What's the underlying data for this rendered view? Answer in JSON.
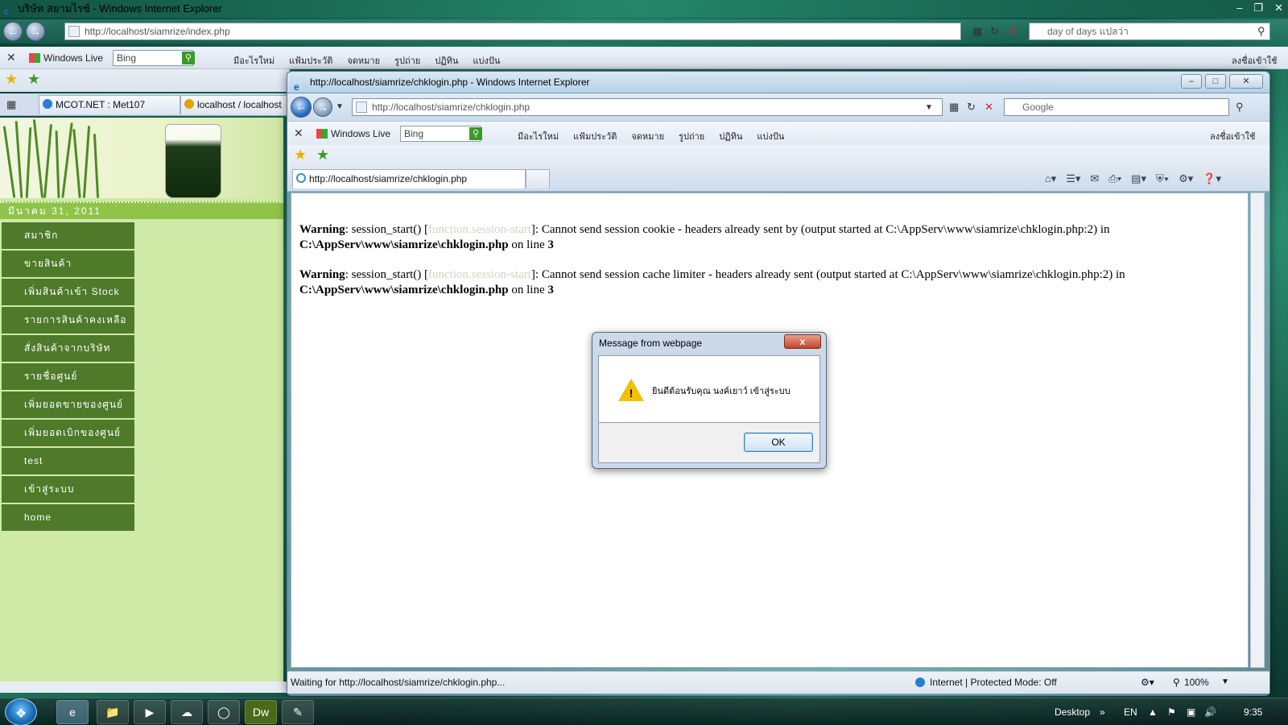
{
  "back_window": {
    "title": "บริษัท สยามไรซ์ - Windows Internet Explorer",
    "address": "http://localhost/siamrize/index.php",
    "search_placeholder": "day of days แปลว่า",
    "live_toolbar": {
      "brand": "Windows Live",
      "search_value": "Bing",
      "menu": [
        "มีอะไรใหม่",
        "แฟ้มประวัติ",
        "จดหมาย",
        "รูปถ่าย",
        "ปฏิทิน",
        "แบ่งปัน"
      ],
      "sign_in": "ลงชื่อเข้าใช้"
    },
    "tabs": [
      {
        "label": "MCOT.NET : Met107"
      },
      {
        "label": "localhost / localhost"
      }
    ],
    "page": {
      "date": "มีนาคม 31, 2011",
      "nav": [
        "สมาชิก",
        "ขายสินค้า",
        "เพิ่มสินค้าเข้า Stock",
        "รายการสินค้าคงเหลือ",
        "สั่งสินค้าจากบริษัท",
        "รายชื่อศูนย์",
        "เพิ่มยอดขายของศูนย์",
        "เพิ่มยอดเบิกของศูนย์",
        "test",
        "เข้าสู่ระบบ",
        "home"
      ]
    }
  },
  "front_window": {
    "title": "http://localhost/siamrize/chklogin.php - Windows Internet Explorer",
    "address": "http://localhost/siamrize/chklogin.php",
    "search_placeholder": "Google",
    "live_toolbar": {
      "brand": "Windows Live",
      "search_value": "Bing",
      "menu": [
        "มีอะไรใหม่",
        "แฟ้มประวัติ",
        "จดหมาย",
        "รูปถ่าย",
        "ปฏิทิน",
        "แบ่งปัน"
      ],
      "sign_in": "ลงชื่อเข้าใช้"
    },
    "tab_label": "http://localhost/siamrize/chklogin.php",
    "warnings": [
      {
        "label": "Warning",
        "pre": ": session_start() [",
        "fn": "function.session-start",
        "post": "]: Cannot send session cookie - headers already sent by (output started at C:\\AppServ\\www\\siamrize\\chklogin.php:2) in",
        "file": "C:\\AppServ\\www\\siamrize\\chklogin.php",
        "line_text": " on line ",
        "line": "3"
      },
      {
        "label": "Warning",
        "pre": ": session_start() [",
        "fn": "function.session-start",
        "post": "]: Cannot send session cache limiter - headers already sent (output started at C:\\AppServ\\www\\siamrize\\chklogin.php:2) in",
        "file": "C:\\AppServ\\www\\siamrize\\chklogin.php",
        "line_text": " on line ",
        "line": "3"
      }
    ],
    "status": {
      "text": "Waiting for http://localhost/siamrize/chklogin.php...",
      "zone": "Internet | Protected Mode: Off",
      "zoom": "100%"
    }
  },
  "dialog": {
    "title": "Message from webpage",
    "close": "x",
    "message": "ยินดีต้อนรับคุณ นงค์เยาว์ เข้าสู่ระบบ",
    "ok_label": "OK"
  },
  "taskbar": {
    "desktop_label": "Desktop",
    "language": "EN",
    "time": "9:35"
  },
  "colors": {
    "nav_bg": "#4e7a2a",
    "page_bg": "#cfe9a7",
    "date_bar": "#8fc34a"
  }
}
